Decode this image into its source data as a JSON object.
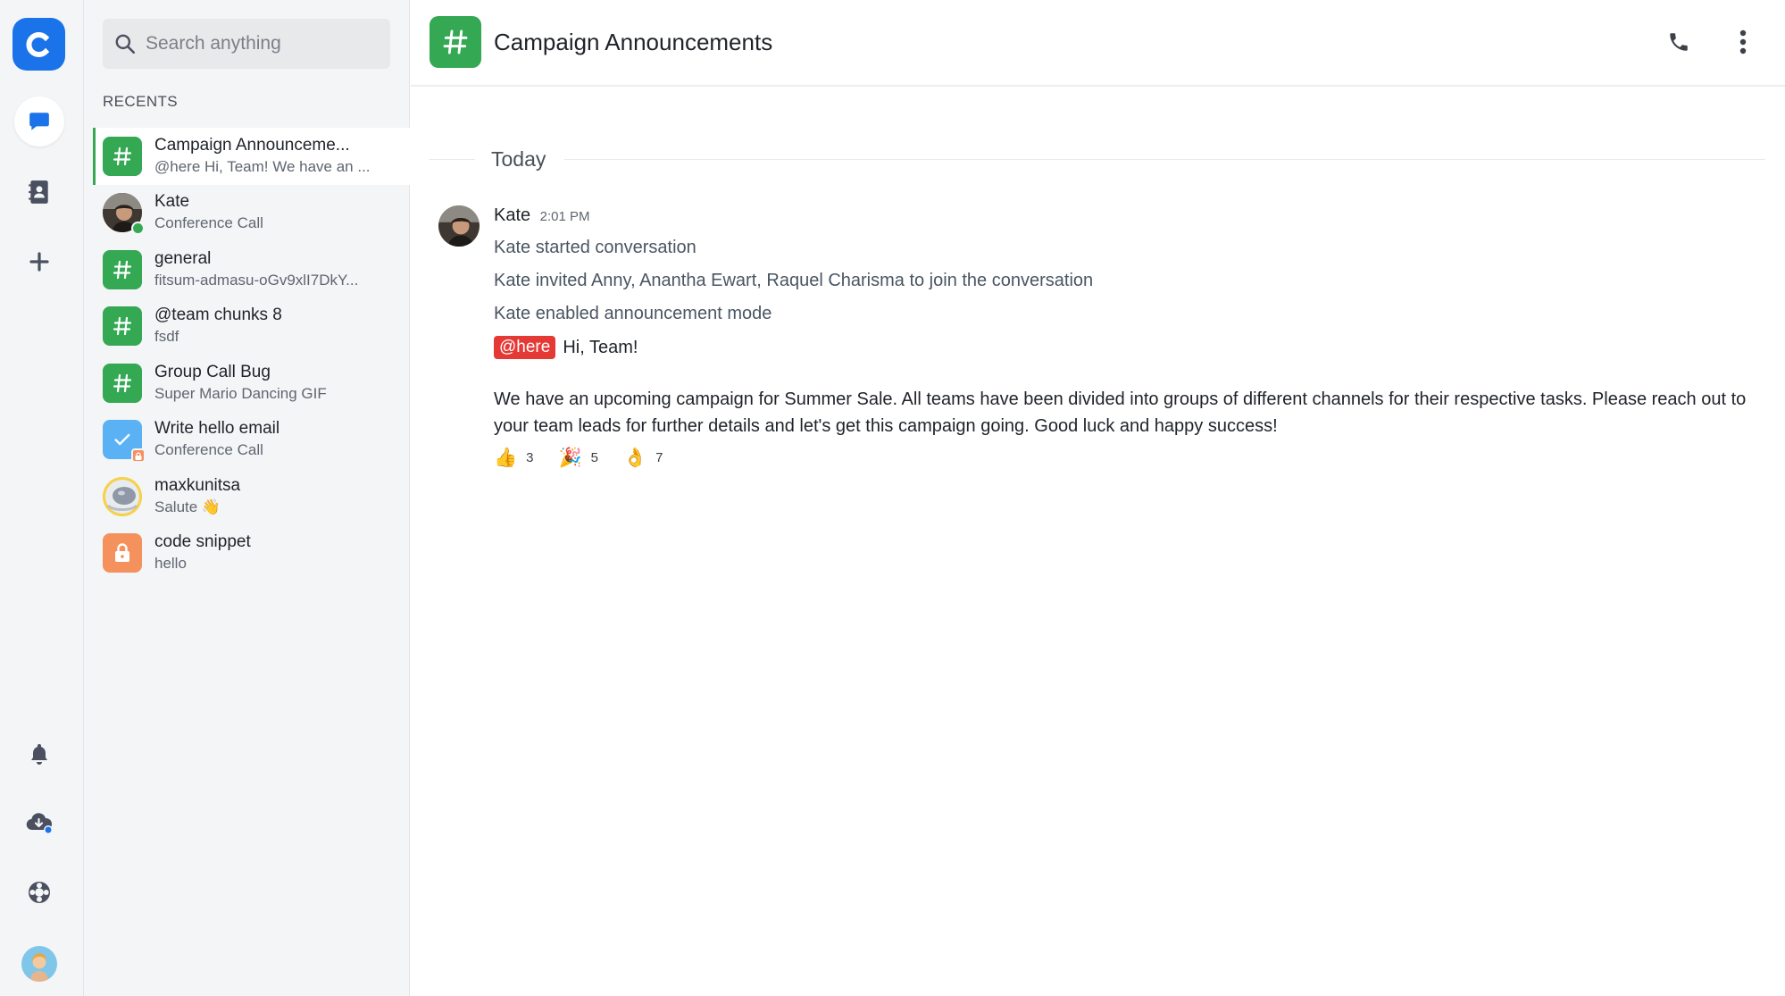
{
  "rail": {
    "logo_letter": "C",
    "items": [
      {
        "icon": "chat-bubble-icon",
        "active": true
      },
      {
        "icon": "contacts-book-icon",
        "active": false
      },
      {
        "icon": "plus-icon",
        "active": false
      }
    ],
    "bottom_items": [
      {
        "icon": "bell-icon"
      },
      {
        "icon": "cloud-download-icon"
      },
      {
        "icon": "lifebuoy-icon"
      }
    ]
  },
  "sidebar": {
    "search_placeholder": "Search anything",
    "recents_label": "RECENTS",
    "conversations": [
      {
        "title": "Campaign Announceme...",
        "subtitle": "@here Hi, Team! We have an ...",
        "avatar": "hash",
        "color": "#34a853",
        "active": true
      },
      {
        "title": "Kate",
        "subtitle": "Conference Call",
        "avatar": "photo",
        "presence": "online"
      },
      {
        "title": "general",
        "subtitle": "fitsum-admasu-oGv9xlI7DkY...",
        "avatar": "hash",
        "color": "#34a853"
      },
      {
        "title": "@team chunks 8",
        "subtitle": "fsdf",
        "avatar": "hash",
        "color": "#34a853"
      },
      {
        "title": "Group Call Bug",
        "subtitle": "Super Mario Dancing GIF",
        "avatar": "hash",
        "color": "#34a853"
      },
      {
        "title": "Write hello email",
        "subtitle": "Conference Call",
        "avatar": "check",
        "color": "#5ab2f5"
      },
      {
        "title": "maxkunitsa",
        "subtitle": "Salute 👋",
        "avatar": "photo-astronaut"
      },
      {
        "title": "code snippet",
        "subtitle": "hello",
        "avatar": "lock",
        "color": "#f4915c"
      }
    ]
  },
  "main": {
    "channel_title": "Campaign Announcements",
    "day_label": "Today",
    "message": {
      "author": "Kate",
      "time": "2:01 PM",
      "system_lines": [
        "Kate started conversation",
        "Kate invited Anny, Anantha Ewart, Raquel Charisma to join the conversation",
        "Kate enabled announcement mode"
      ],
      "mention": "@here",
      "greeting": "Hi, Team!",
      "text": "We have an upcoming campaign for Summer Sale. All teams have been divided into groups of different channels for their respective tasks. Please reach out to your team leads for further details and let's get this campaign going. Good luck and happy success!",
      "reactions": [
        {
          "emoji": "👍",
          "count": "3"
        },
        {
          "emoji": "🎉",
          "count": "5"
        },
        {
          "emoji": "👌",
          "count": "7"
        }
      ]
    }
  },
  "colors": {
    "brand": "#1a73e8",
    "channel_green": "#34a853",
    "mention_red": "#e53935"
  }
}
